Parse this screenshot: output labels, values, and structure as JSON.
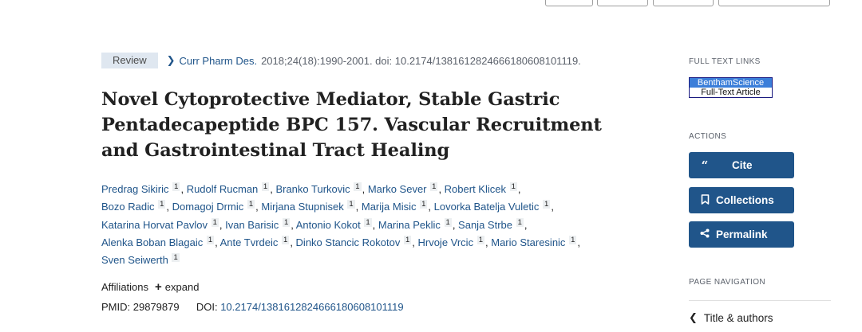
{
  "article": {
    "type_badge": "Review",
    "journal": "Curr Pharm Des.",
    "citation": "2018;24(18):1990-2001. doi: 10.2174/1381612824666180608101119.",
    "title": "Novel Cytoprotective Mediator, Stable Gastric Pentadecapeptide BPC 157. Vascular Recruitment and Gastrointestinal Tract Healing",
    "affiliation_marker": "1",
    "authors": [
      "Predrag Sikiric",
      "Rudolf Rucman",
      "Branko Turkovic",
      "Marko Sever",
      "Robert Klicek",
      "Bozo Radic",
      "Domagoj Drmic",
      "Mirjana Stupnisek",
      "Marija Misic",
      "Lovorka Batelja Vuletic",
      "Katarina Horvat Pavlov",
      "Ivan Barisic",
      "Antonio Kokot",
      "Marina Peklic",
      "Sanja Strbe",
      "Alenka Boban Blagaic",
      "Ante Tvrdeic",
      "Dinko Stancic Rokotov",
      "Hrvoje Vrcic",
      "Mario Staresinic",
      "Sven Seiwerth"
    ],
    "affiliations_label": "Affiliations",
    "expand_label": "expand",
    "pmid_label": "PMID:",
    "pmid": "29879879",
    "doi_label": "DOI:",
    "doi": "10.2174/1381612824666180608101119"
  },
  "sidebar": {
    "full_text_heading": "FULL TEXT LINKS",
    "full_text_link_top": "BenthamScience",
    "full_text_link_bottom": "Full-Text Article",
    "actions_heading": "ACTIONS",
    "cite_label": "Cite",
    "collections_label": "Collections",
    "permalink_label": "Permalink",
    "page_nav_heading": "PAGE NAVIGATION",
    "nav_title_authors": "Title & authors"
  },
  "colors": {
    "link": "#20558a",
    "button_bg": "#20558a",
    "badge_bg": "#dfe7f0",
    "affiliation_marker_bg": "#eceff1"
  },
  "icons": {
    "journal_chevron": "chevron-right-icon",
    "cite": "quote-icon",
    "collections": "bookmark-icon",
    "permalink": "share-icon",
    "expand": "plus-icon",
    "nav": "chevron-left-icon"
  }
}
